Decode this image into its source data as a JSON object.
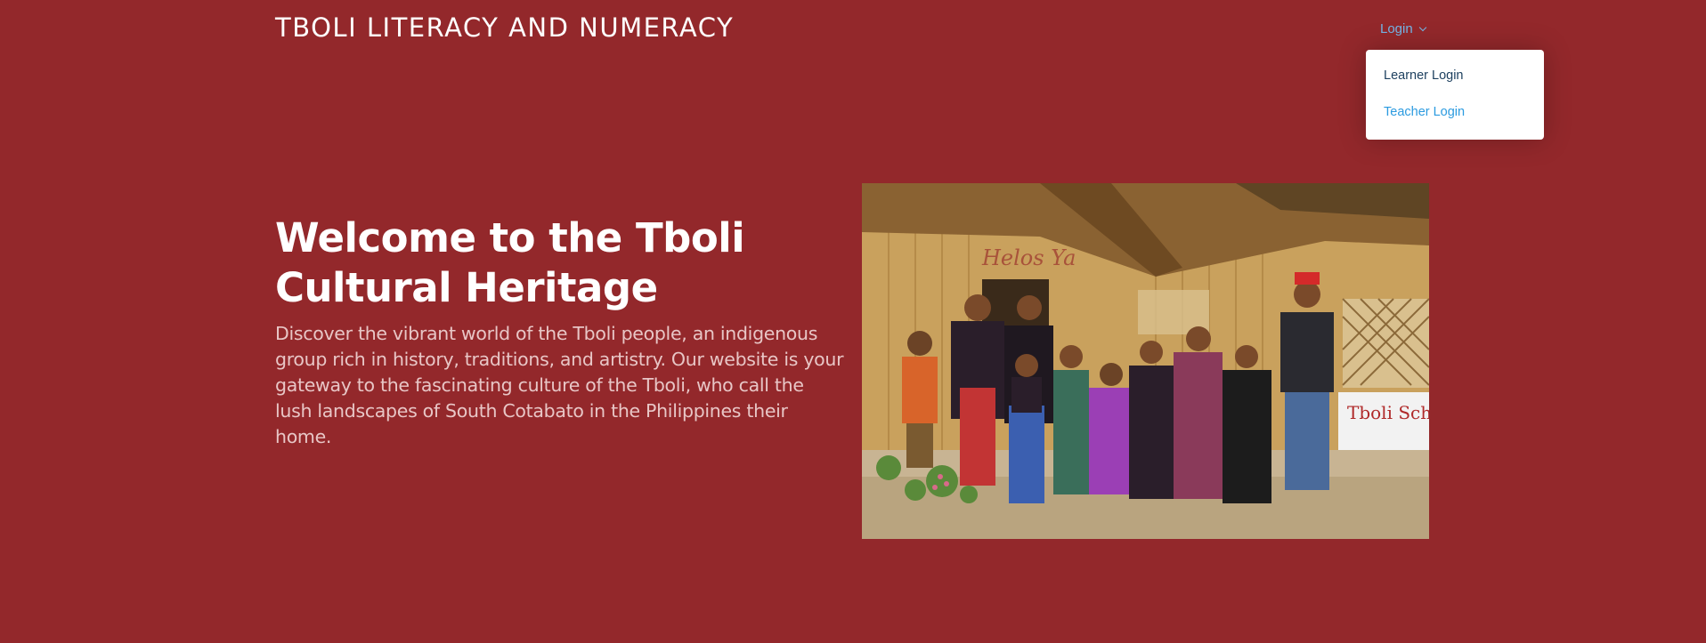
{
  "header": {
    "brand": "TBOLI LITERACY AND NUMERACY",
    "login_label": "Login"
  },
  "login_menu": {
    "items": [
      {
        "label": "Learner Login"
      },
      {
        "label": "Teacher Login"
      }
    ]
  },
  "hero": {
    "title": "Welcome to the Tboli Cultural Heritage",
    "description": "Discover the vibrant world of the Tboli people, an indigenous group rich in history, traditions, and artistry. Our website is your gateway to the fascinating culture of the Tboli, who call the lush landscapes of South Cotabato in the Philippines their home.",
    "photo": {
      "sign_text": "Tboli School",
      "wall_text": "Helos Ya"
    }
  },
  "colors": {
    "background": "#93282b",
    "link": "#74b5e6",
    "teacher_link": "#2c9be0"
  },
  "icons": {
    "login_chevron": "chevron-down-icon"
  }
}
